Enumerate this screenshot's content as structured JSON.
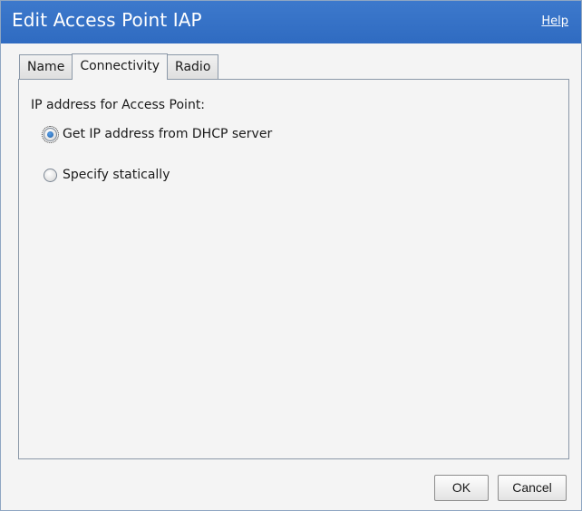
{
  "window": {
    "title": "Edit Access Point IAP",
    "help_label": "Help"
  },
  "tabs": [
    {
      "label": "Name",
      "active": false
    },
    {
      "label": "Connectivity",
      "active": true
    },
    {
      "label": "Radio",
      "active": false
    }
  ],
  "connectivity": {
    "heading": "IP address for Access Point:",
    "options": [
      {
        "label": "Get IP address from DHCP server",
        "selected": true
      },
      {
        "label": "Specify statically",
        "selected": false
      }
    ]
  },
  "buttons": {
    "ok_label": "OK",
    "cancel_label": "Cancel"
  },
  "colors": {
    "titlebar": "#3370c6",
    "title_text": "#ffffff",
    "dialog_bg": "#f4f4f4",
    "border": "#8b98a8"
  }
}
